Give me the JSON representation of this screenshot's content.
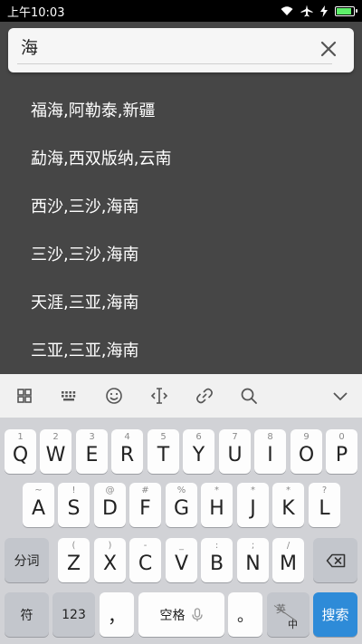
{
  "status_bar": {
    "time": "上午10:03"
  },
  "search": {
    "value": "海"
  },
  "results": [
    "福海,阿勒泰,新疆",
    "勐海,西双版纳,云南",
    "西沙,三沙,海南",
    "三沙,三沙,海南",
    "天涯,三亚,海南",
    "三亚,三亚,海南"
  ],
  "keyboard": {
    "row1": [
      {
        "key": "Q",
        "num": "1"
      },
      {
        "key": "W",
        "num": "2"
      },
      {
        "key": "E",
        "num": "3"
      },
      {
        "key": "R",
        "num": "4"
      },
      {
        "key": "T",
        "num": "5"
      },
      {
        "key": "Y",
        "num": "6"
      },
      {
        "key": "U",
        "num": "7"
      },
      {
        "key": "I",
        "num": "8"
      },
      {
        "key": "O",
        "num": "9"
      },
      {
        "key": "P",
        "num": "0"
      }
    ],
    "row2": [
      {
        "key": "A",
        "sym": "~"
      },
      {
        "key": "S",
        "sym": "!"
      },
      {
        "key": "D",
        "sym": "@"
      },
      {
        "key": "F",
        "sym": "#"
      },
      {
        "key": "G",
        "sym": "%"
      },
      {
        "key": "H",
        "sym": "*"
      },
      {
        "key": "J",
        "sym": "*"
      },
      {
        "key": "K",
        "sym": "*"
      },
      {
        "key": "L",
        "sym": "?"
      }
    ],
    "row3": [
      {
        "key": "Z",
        "sym": "("
      },
      {
        "key": "X",
        "sym": ")"
      },
      {
        "key": "C",
        "sym": "-"
      },
      {
        "key": "V",
        "sym": "_"
      },
      {
        "key": "B",
        "sym": ":"
      },
      {
        "key": "N",
        "sym": ";"
      },
      {
        "key": "M",
        "sym": "/"
      }
    ],
    "fenci_label": "分词",
    "symbol_label": "符",
    "number_label": "123",
    "comma_label": "，",
    "space_label": "空格",
    "period_label": "。",
    "lang_top": "英",
    "lang_bottom": "中",
    "search_label": "搜索"
  }
}
